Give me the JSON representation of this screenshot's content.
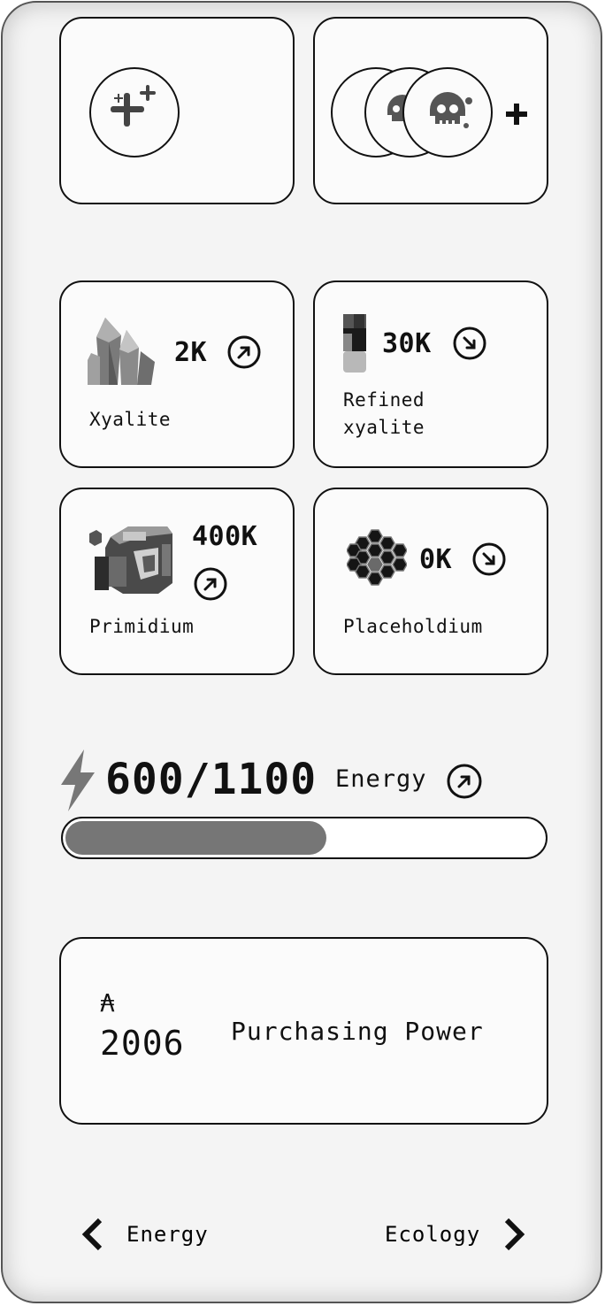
{
  "resources": [
    {
      "name": "Xyalite",
      "amount": "2K",
      "trend": "up",
      "icon": "crystal-icon"
    },
    {
      "name": "Refined\nxyalite",
      "amount": "30K",
      "trend": "down",
      "icon": "vial-icon"
    },
    {
      "name": "Primidium",
      "amount": "400K",
      "trend": "up",
      "icon": "ore-block-icon"
    },
    {
      "name": "Placeholdium",
      "amount": "0K",
      "trend": "down",
      "icon": "hexagon-cluster-icon"
    }
  ],
  "energy": {
    "value": "600/1100",
    "label": "Energy",
    "fill_fraction": 0.5455,
    "trend": "up"
  },
  "purchasing_power": {
    "symbol": "₳",
    "value": "2006",
    "label": "Purchasing Power"
  },
  "nav": {
    "prev_label": "Energy",
    "next_label": "Ecology"
  },
  "colors": {
    "border": "#111111",
    "bar_fill": "#767676",
    "panel_bg": "#f4f4f4"
  }
}
